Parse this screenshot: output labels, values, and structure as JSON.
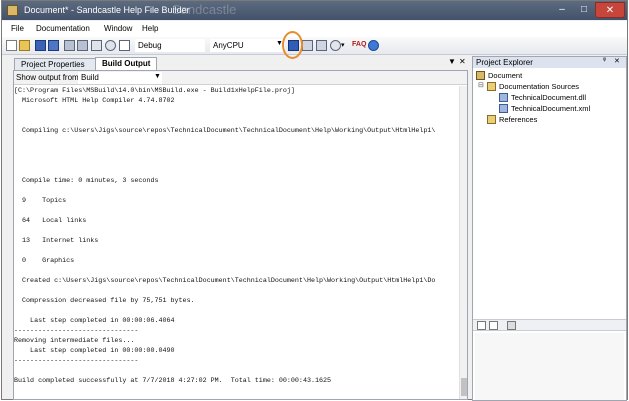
{
  "window": {
    "title": "Document* - Sandcastle Help File Builder",
    "ghost_title": "Sandcastle",
    "controls": {
      "minimize": "–",
      "maximize": "□",
      "close": "✕"
    }
  },
  "menu": [
    "File",
    "Documentation",
    "Window",
    "Help"
  ],
  "toolbar": {
    "configuration": "Debug",
    "platform": "AnyCPU",
    "faq_label": "FAQ",
    "icons": [
      "new-project-icon",
      "open-icon",
      "save-icon",
      "save-all-icon",
      "project-icon",
      "cut-icon",
      "copy-icon",
      "find-icon",
      "help-file-icon",
      "build-icon",
      "view-help-icon",
      "cancel-build-icon",
      "search-icon",
      "faq-icon",
      "about-icon"
    ],
    "accent": "#e88c2c"
  },
  "tabs": [
    {
      "label": "Project Properties",
      "active": false
    },
    {
      "label": "Build Output",
      "active": true
    }
  ],
  "output": {
    "show_label": "Show output from",
    "show_value": "Build",
    "lines": [
      "[C:\\Program Files\\MSBuild\\14.0\\bin\\MSBuild.exe - Build1xHelpFile.proj]",
      "  Microsoft HTML Help Compiler 4.74.8702",
      "",
      "",
      "  Compiling c:\\Users\\Jigs\\source\\repos\\TechnicalDocument\\TechnicalDocument\\Help\\Working\\Output\\HtmlHelp1\\",
      "",
      "",
      "",
      "",
      "  Compile time: 0 minutes, 3 seconds",
      "",
      "  9    Topics",
      "",
      "  64   Local links",
      "",
      "  13   Internet links",
      "",
      "  0    Graphics",
      "",
      "  Created c:\\Users\\Jigs\\source\\repos\\TechnicalDocument\\TechnicalDocument\\Help\\Working\\Output\\HtmlHelp1\\Do",
      "",
      "  Compression decreased file by 75,751 bytes.",
      "",
      "    Last step completed in 00:00:06.4064",
      "-------------------------------",
      "Removing intermediate files...",
      "    Last step completed in 00:00:00.0490",
      "-------------------------------",
      "",
      "Build completed successfully at 7/7/2018 4:27:02 PM.  Total time: 00:00:43.1625"
    ]
  },
  "explorer": {
    "title": "Project Explorer",
    "pin": "ᵠ",
    "close": "✕",
    "root": "Document",
    "sources_label": "Documentation Sources",
    "files": [
      "TechnicalDocument.dll",
      "TechnicalDocument.xml"
    ],
    "references": "References"
  }
}
